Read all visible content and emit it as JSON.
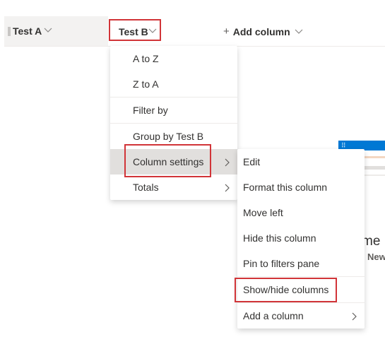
{
  "header": {
    "col_a_label": "Test A",
    "col_b_label": "Test B",
    "add_column_label": "Add column"
  },
  "column_menu": {
    "items": [
      {
        "label": "A to Z"
      },
      {
        "label": "Z to A"
      },
      {
        "label": "Filter by"
      },
      {
        "label": "Group by Test B"
      },
      {
        "label": "Column settings",
        "has_submenu": true,
        "highlighted": true
      },
      {
        "label": "Totals",
        "has_submenu": true
      }
    ]
  },
  "settings_submenu": {
    "items": [
      {
        "label": "Edit"
      },
      {
        "label": "Format this column"
      },
      {
        "label": "Move left"
      },
      {
        "label": "Hide this column"
      },
      {
        "label": "Pin to filters pane"
      },
      {
        "label": "Show/hide columns",
        "highlighted_box": true
      },
      {
        "label": "Add a column",
        "has_submenu": true
      }
    ]
  },
  "background": {
    "partial_text_1": "me",
    "partial_text_2": "New"
  },
  "colors": {
    "highlight_box": "#d13438",
    "hover_bg": "#e1dfdd",
    "accent": "#0078d4"
  },
  "icons": {
    "dropdown": "chevron-down-icon",
    "submenu": "chevron-right-icon",
    "add": "plus-icon",
    "grip": "column-grip-icon",
    "waffle": "dots-grid-icon"
  }
}
